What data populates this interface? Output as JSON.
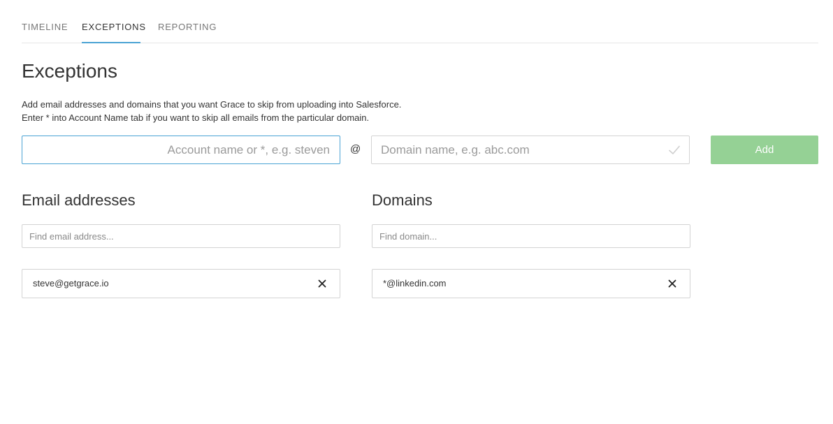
{
  "tabs": [
    {
      "label": "TIMELINE",
      "active": false
    },
    {
      "label": "EXCEPTIONS",
      "active": true
    },
    {
      "label": "REPORTING",
      "active": false
    }
  ],
  "page": {
    "title": "Exceptions",
    "description_line1": "Add email addresses and domains that you want Grace to skip from uploading into Salesforce.",
    "description_line2": "Enter * into Account Name tab if you want to skip all emails from the particular domain."
  },
  "add_form": {
    "account_placeholder": "Account name or *, e.g. steven",
    "at_sign": "@",
    "domain_placeholder": "Domain name, e.g. abc.com",
    "add_label": "Add",
    "add_button_color": "#95d195",
    "check_icon": "check-icon"
  },
  "email_section": {
    "title": "Email addresses",
    "search_placeholder": "Find email address...",
    "items": [
      {
        "label": "steve@getgrace.io",
        "remove_icon": "close-icon"
      }
    ]
  },
  "domain_section": {
    "title": "Domains",
    "search_placeholder": "Find domain...",
    "items": [
      {
        "label": "*@linkedin.com",
        "remove_icon": "close-icon"
      }
    ]
  },
  "colors": {
    "accent": "#4aa3d4",
    "text": "#333333",
    "muted": "#777777",
    "border": "#d3d3d3"
  }
}
